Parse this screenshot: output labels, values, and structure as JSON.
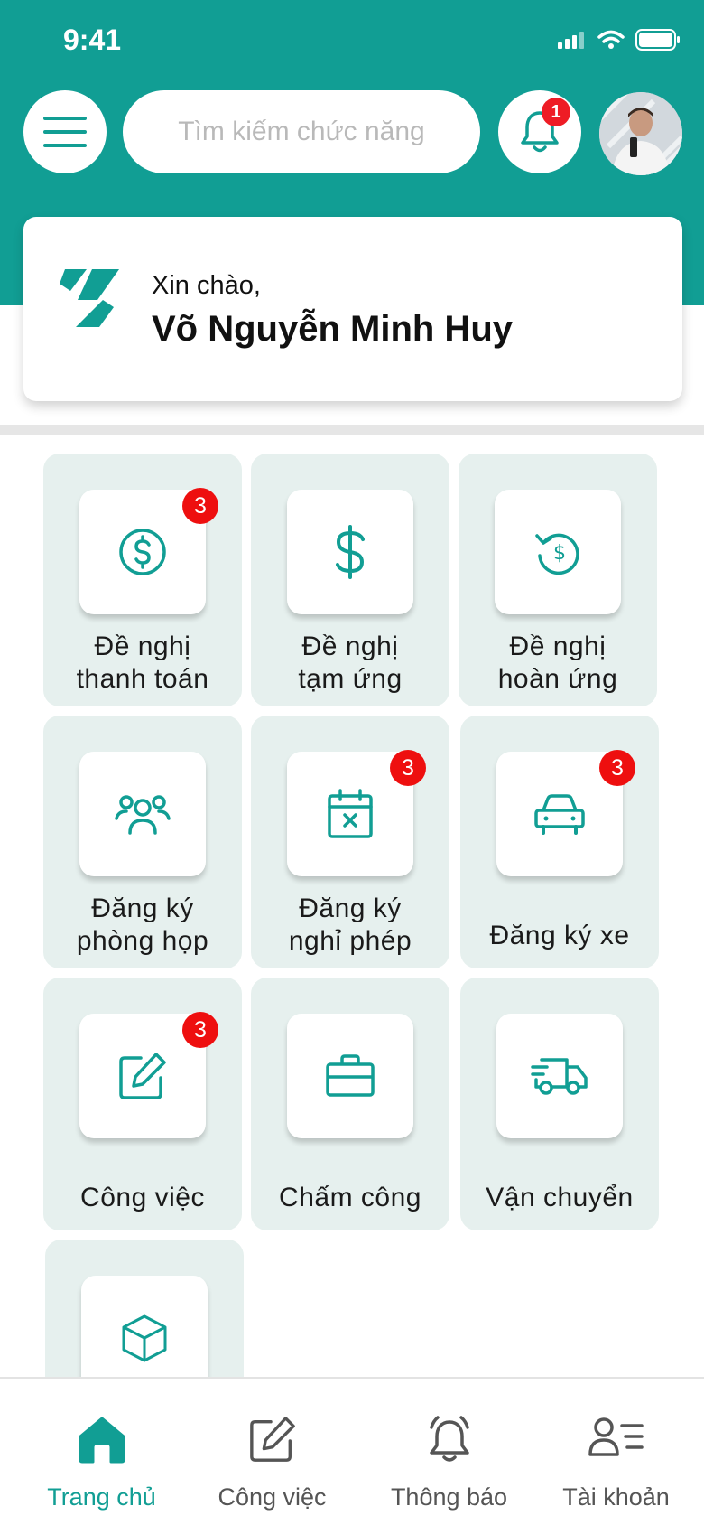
{
  "status_bar": {
    "time": "9:41"
  },
  "header": {
    "search_placeholder": "Tìm kiếm chức năng",
    "notification_count": "1"
  },
  "greeting": {
    "hello": "Xin chào,",
    "name": "Võ Nguyễn Minh Huy"
  },
  "tiles": [
    {
      "label": "Đề nghị thanh toán",
      "line1": "Đề nghị",
      "line2": "thanh toán",
      "icon": "dollar-circle-icon",
      "badge": "3"
    },
    {
      "label": "Đề nghị tạm ứng",
      "line1": "Đề nghị",
      "line2": "tạm ứng",
      "icon": "dollar-icon",
      "badge": ""
    },
    {
      "label": "Đề nghị hoàn ứng",
      "line1": "Đề nghị",
      "line2": "hoàn ứng",
      "icon": "refund-icon",
      "badge": ""
    },
    {
      "label": "Đăng ký phòng họp",
      "line1": "Đăng ký",
      "line2": "phòng họp",
      "icon": "users-icon",
      "badge": ""
    },
    {
      "label": "Đăng ký nghỉ phép",
      "line1": "Đăng ký",
      "line2": "nghỉ phép",
      "icon": "calendar-x-icon",
      "badge": "3"
    },
    {
      "label": "Đăng ký xe",
      "line1": "Đăng ký xe",
      "line2": "",
      "icon": "car-icon",
      "badge": "3"
    },
    {
      "label": "Công việc",
      "line1": "Công việc",
      "line2": "",
      "icon": "edit-icon",
      "badge": "3"
    },
    {
      "label": "Chấm công",
      "line1": "Chấm công",
      "line2": "",
      "icon": "briefcase-icon",
      "badge": ""
    },
    {
      "label": "Vận chuyển",
      "line1": "Vận chuyển",
      "line2": "",
      "icon": "truck-icon",
      "badge": ""
    },
    {
      "label": "",
      "line1": "",
      "line2": "",
      "icon": "cube-icon",
      "badge": ""
    }
  ],
  "bottom_nav": [
    {
      "label": "Trang chủ",
      "icon": "home-icon",
      "active": true
    },
    {
      "label": "Công việc",
      "icon": "edit-icon",
      "active": false
    },
    {
      "label": "Thông báo",
      "icon": "bell-icon",
      "active": false
    },
    {
      "label": "Tài khoản",
      "icon": "account-list-icon",
      "active": false
    }
  ],
  "colors": {
    "primary": "#119e94",
    "badge": "#ee0f0f",
    "tile_bg": "#e6f0ee"
  }
}
